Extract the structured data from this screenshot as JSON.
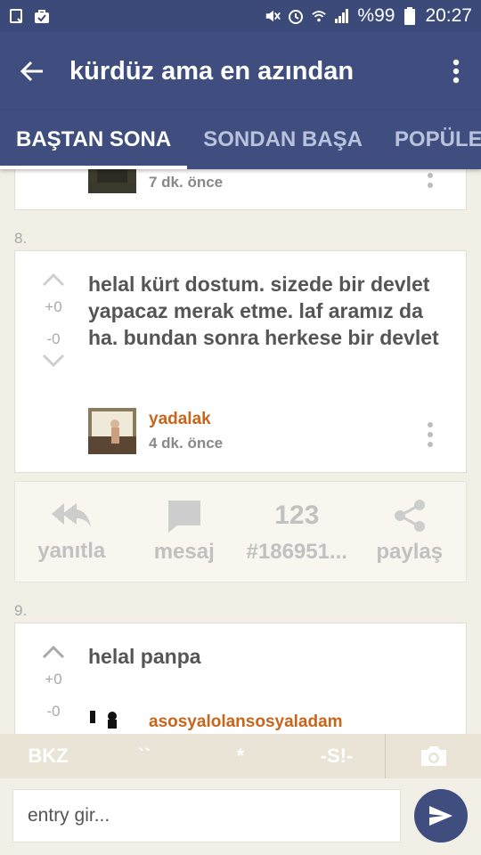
{
  "status_bar": {
    "battery_text": "%99",
    "time": "20:27",
    "icons": [
      "notification-icon",
      "bag-icon",
      "mute-icon",
      "alarm-icon",
      "wifi-icon",
      "signal-icon",
      "battery-icon"
    ]
  },
  "app_bar": {
    "title": "kürdüz ama en azından",
    "back_icon": "arrow-back-icon",
    "menu_icon": "more-vert-icon"
  },
  "tabs": [
    {
      "label": "BAŞTAN SONA",
      "active": true
    },
    {
      "label": "SONDAN BAŞA",
      "active": false
    },
    {
      "label": "POPÜLER",
      "active": false
    }
  ],
  "entries": [
    {
      "partial": true,
      "time": "7 dk. önce"
    },
    {
      "number": "8.",
      "text": "helal kürt dostum. sizede bir devlet yapacaz merak etme. laf aramız da ha. bundan sonra herkese bir devlet",
      "up_count": "+0",
      "down_count": "-0",
      "author": "yadalak",
      "time": "4 dk. önce"
    },
    {
      "number": "9.",
      "text": "helal panpa",
      "up_count": "+0",
      "down_count": "-0",
      "author": "asosyalolansosyaladam"
    }
  ],
  "actions": [
    {
      "label": "yanıtla",
      "icon": "reply-all-icon"
    },
    {
      "label": "mesaj",
      "icon": "message-icon"
    },
    {
      "label": "#186951...",
      "icon": "number-icon",
      "icon_text": "123"
    },
    {
      "label": "paylaş",
      "icon": "share-icon"
    }
  ],
  "editor_toolbar": {
    "bkz": "BKZ",
    "quote": "``",
    "star": "*",
    "spoiler": "-S!-",
    "camera_icon": "camera-icon"
  },
  "input": {
    "placeholder": "entry gir...",
    "send_icon": "send-icon"
  },
  "colors": {
    "primary": "#3f4e7e",
    "author": "#c9641b",
    "background": "#f2efe6"
  }
}
